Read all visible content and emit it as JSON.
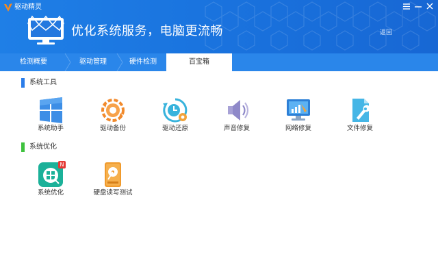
{
  "app": {
    "title": "驱动精灵",
    "slogan": "优化系统服务，电脑更流畅",
    "back": "返回"
  },
  "window_controls": [
    "menu-icon",
    "minimize-icon",
    "close-icon"
  ],
  "tabs": [
    {
      "label": "检测概要",
      "active": false
    },
    {
      "label": "驱动管理",
      "active": false
    },
    {
      "label": "硬件检测",
      "active": false
    },
    {
      "label": "百宝箱",
      "active": true
    }
  ],
  "sections": [
    {
      "title": "系统工具",
      "color": "#2b7de9",
      "tools": [
        {
          "label": "系统助手",
          "icon": "windows-icon"
        },
        {
          "label": "驱动备份",
          "icon": "gear-backup-icon"
        },
        {
          "label": "驱动还原",
          "icon": "restore-clock-icon"
        },
        {
          "label": "声音修复",
          "icon": "speaker-icon"
        },
        {
          "label": "网络修复",
          "icon": "network-monitor-icon"
        },
        {
          "label": "文件修复",
          "icon": "file-wrench-icon"
        }
      ]
    },
    {
      "title": "系统优化",
      "color": "#3fc23f",
      "tools": [
        {
          "label": "系统优化",
          "icon": "system-optimize-icon",
          "badge": "N"
        },
        {
          "label": "硬盘读写测试",
          "icon": "disk-test-icon"
        }
      ]
    }
  ],
  "colors": {
    "header": "#1f7fe6",
    "tabbar": "#2a86ea",
    "accent_blue": "#2b7de9",
    "accent_green": "#3fc23f"
  }
}
